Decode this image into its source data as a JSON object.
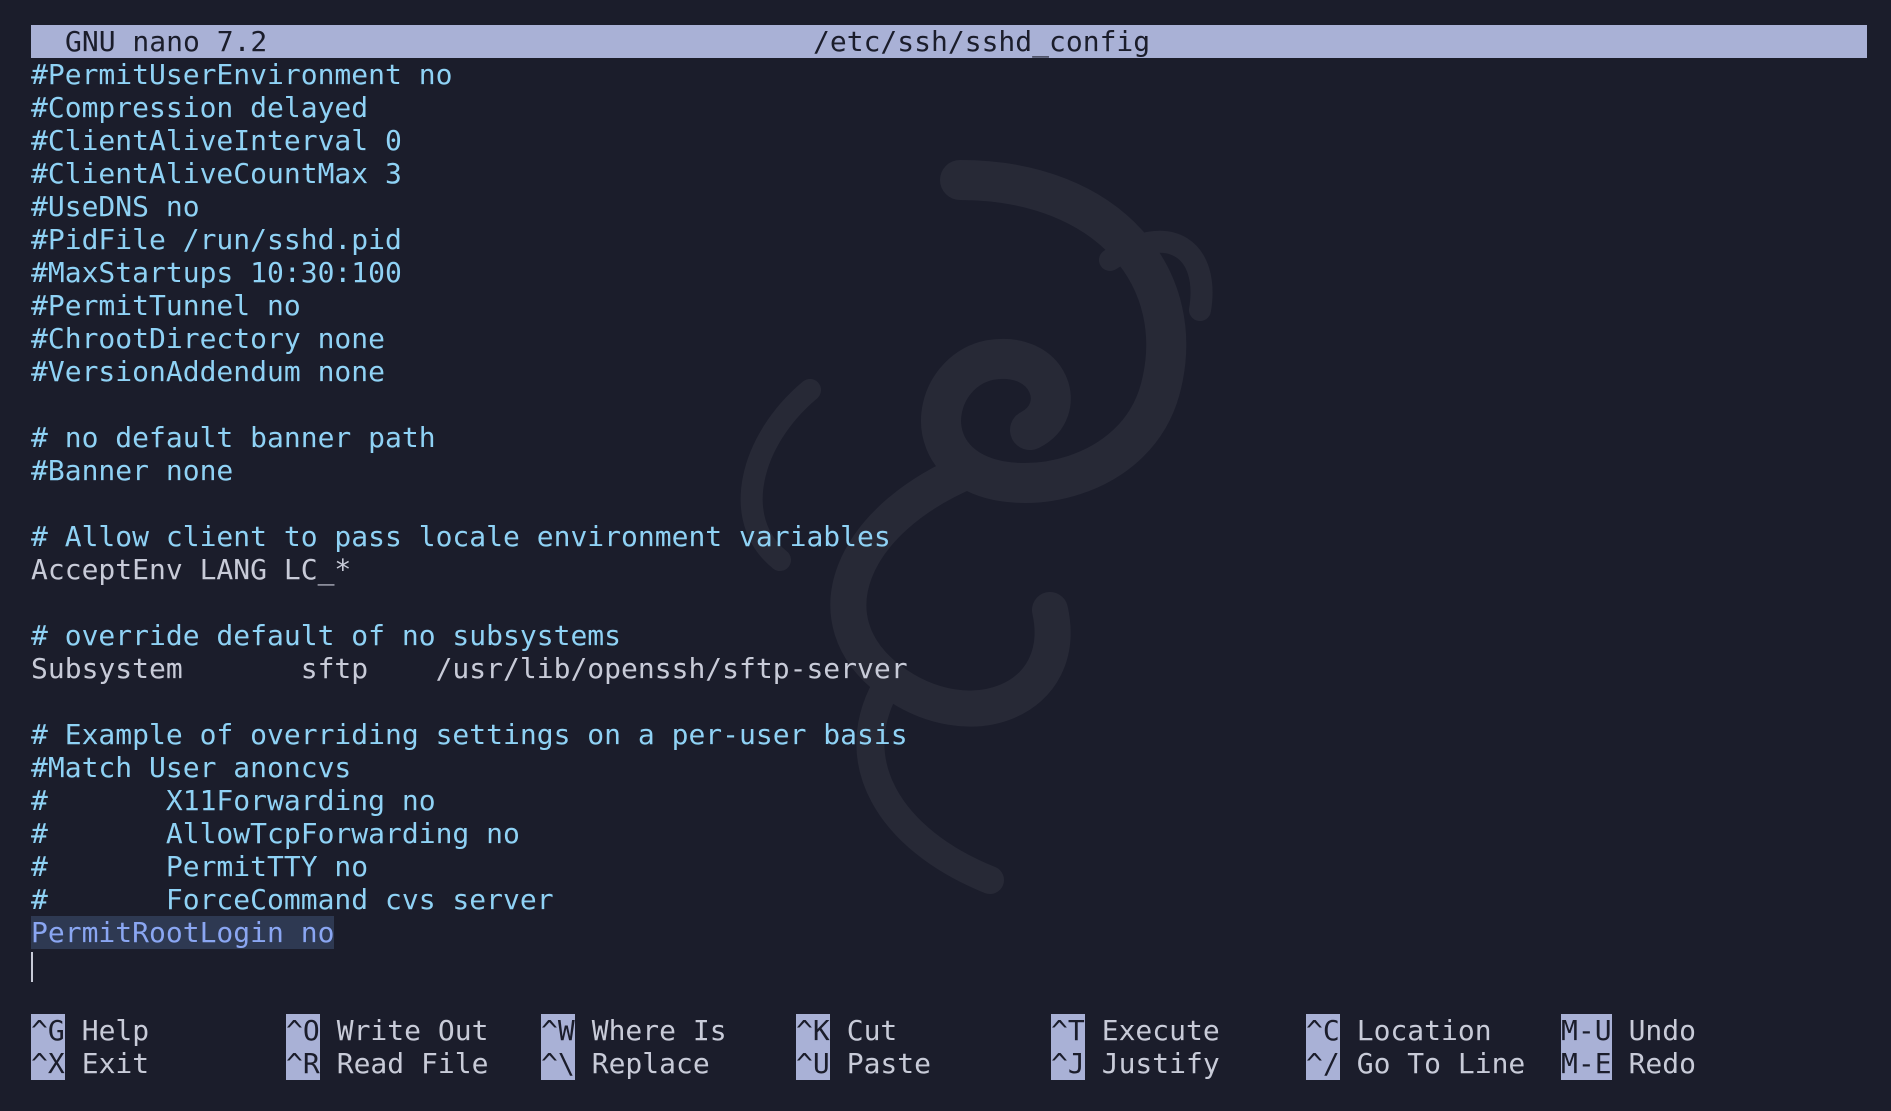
{
  "titlebar": {
    "version": "GNU nano 7.2",
    "filename": "/etc/ssh/sshd_config"
  },
  "editor": {
    "lines": [
      {
        "text": "#PermitUserEnvironment no",
        "style": "comment"
      },
      {
        "text": "#Compression delayed",
        "style": "comment"
      },
      {
        "text": "#ClientAliveInterval 0",
        "style": "comment"
      },
      {
        "text": "#ClientAliveCountMax 3",
        "style": "comment"
      },
      {
        "text": "#UseDNS no",
        "style": "comment"
      },
      {
        "text": "#PidFile /run/sshd.pid",
        "style": "comment"
      },
      {
        "text": "#MaxStartups 10:30:100",
        "style": "comment"
      },
      {
        "text": "#PermitTunnel no",
        "style": "comment"
      },
      {
        "text": "#ChrootDirectory none",
        "style": "comment"
      },
      {
        "text": "#VersionAddendum none",
        "style": "comment"
      },
      {
        "text": "",
        "style": "plain"
      },
      {
        "text": "# no default banner path",
        "style": "comment"
      },
      {
        "text": "#Banner none",
        "style": "comment"
      },
      {
        "text": "",
        "style": "plain"
      },
      {
        "text": "# Allow client to pass locale environment variables",
        "style": "comment"
      },
      {
        "text": "AcceptEnv LANG LC_*",
        "style": "plain"
      },
      {
        "text": "",
        "style": "plain"
      },
      {
        "text": "# override default of no subsystems",
        "style": "comment"
      },
      {
        "text": "Subsystem       sftp    /usr/lib/openssh/sftp-server",
        "style": "plain"
      },
      {
        "text": "",
        "style": "plain"
      },
      {
        "text": "# Example of overriding settings on a per-user basis",
        "style": "comment"
      },
      {
        "text": "#Match User anoncvs",
        "style": "comment"
      },
      {
        "text": "#       X11Forwarding no",
        "style": "comment"
      },
      {
        "text": "#       AllowTcpForwarding no",
        "style": "comment"
      },
      {
        "text": "#       PermitTTY no",
        "style": "comment"
      },
      {
        "text": "#       ForceCommand cvs server",
        "style": "comment"
      },
      {
        "text": "PermitRootLogin no",
        "style": "selected"
      }
    ]
  },
  "shortcuts": {
    "top": [
      {
        "key": "^G",
        "label": "Help"
      },
      {
        "key": "^O",
        "label": "Write Out"
      },
      {
        "key": "^W",
        "label": "Where Is"
      },
      {
        "key": "^K",
        "label": "Cut"
      },
      {
        "key": "^T",
        "label": "Execute"
      },
      {
        "key": "^C",
        "label": "Location"
      },
      {
        "key": "M-U",
        "label": "Undo"
      }
    ],
    "bottom": [
      {
        "key": "^X",
        "label": "Exit"
      },
      {
        "key": "^R",
        "label": "Read File"
      },
      {
        "key": "^\\",
        "label": "Replace"
      },
      {
        "key": "^U",
        "label": "Paste"
      },
      {
        "key": "^J",
        "label": "Justify"
      },
      {
        "key": "^/",
        "label": "Go To Line"
      },
      {
        "key": "M-E",
        "label": "Redo"
      }
    ]
  },
  "colors": {
    "background": "#1b1d2b",
    "bar": "#a9b1d6",
    "comment": "#8fd2f5",
    "text": "#c8cbd8",
    "selection": "#2e3952"
  }
}
